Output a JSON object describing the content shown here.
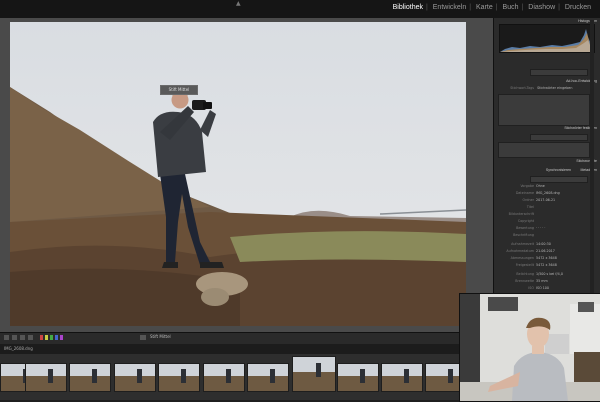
{
  "modules": {
    "items": [
      "Bibliothek",
      "Entwickeln",
      "Karte",
      "Buch",
      "Diashow",
      "Drucken"
    ],
    "active": "Bibliothek"
  },
  "viewer": {
    "tooltip": "Stift Mittel"
  },
  "right_panel": {
    "histogram_title": "Histogramm",
    "quick_develop_title": "Ad-hoc-Entwicklung",
    "keywords_title": "Stichwörter festlegen",
    "keyword_set_label": "Stichwort-Tags",
    "keyword_set_value": "Stichwörter eingeben",
    "keyword_list_title": "Stichwortliste",
    "metadata_title": "Metadaten",
    "sync_label": "Synchronisieren",
    "metadata_rows": [
      {
        "k": "Vorgabe",
        "v": "Ohne"
      },
      {
        "k": "Dateiname",
        "v": "IMG_2608.dng"
      },
      {
        "k": "Ordner",
        "v": "2017-06-21"
      },
      {
        "k": "Titel",
        "v": ""
      },
      {
        "k": "Bildunterschrift",
        "v": ""
      },
      {
        "k": "Copyright",
        "v": ""
      },
      {
        "k": "Bewertung",
        "v": "· · · · ·"
      },
      {
        "k": "Beschriftung",
        "v": ""
      },
      {
        "k": "Aufnahmezeit",
        "v": "14:00:30"
      },
      {
        "k": "Aufnahmedatum",
        "v": "21.06.2017"
      },
      {
        "k": "Abmessungen",
        "v": "5472 x 3648"
      },
      {
        "k": "Freigestellt",
        "v": "5472 x 3648"
      },
      {
        "k": "Belichtung",
        "v": "1/500 s bei f/4,0"
      },
      {
        "k": "Brennweite",
        "v": "35 mm"
      },
      {
        "k": "ISO",
        "v": "ISO 100"
      },
      {
        "k": "Objektiv",
        "v": "24.0-70.0 mm"
      }
    ]
  },
  "toolbar": {
    "label": "Stift Mittel"
  },
  "filmstrip": {
    "title": "IMG_2608.dng"
  },
  "colors": {
    "active_module": "#ffffff",
    "panel_bg": "#2b2b2b",
    "viewer_bg": "#4a4a4a"
  }
}
